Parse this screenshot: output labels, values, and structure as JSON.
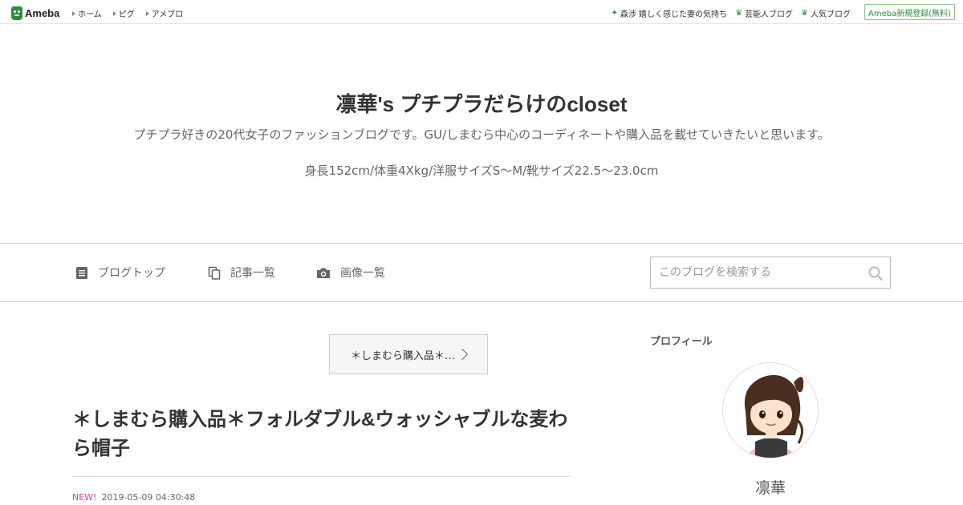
{
  "topbar": {
    "logo_text": "Ameba",
    "global_nav": [
      "ホーム",
      "ピグ",
      "アメブロ"
    ],
    "right_nav": [
      {
        "icon": "sparkle-icon",
        "label": "森渉 嬉しく感じた妻の気持ち"
      },
      {
        "icon": "crown-icon",
        "label": "芸能人ブログ"
      },
      {
        "icon": "crown-icon",
        "label": "人気ブログ"
      }
    ],
    "register_label": "Ameba新規登録(無料)"
  },
  "blog": {
    "title": "凛華's プチプラだらけのcloset",
    "description_1": "プチプラ好きの20代女子のファッションブログです。GU/しまむら中心のコーディネートや購入品を載せていきたいと思います。",
    "description_2": "身長152cm/体重4Xkg/洋服サイズS〜M/靴サイズ22.5〜23.0cm"
  },
  "blognav": {
    "items": [
      {
        "icon": "document-icon",
        "label": "ブログトップ"
      },
      {
        "icon": "copy-icon",
        "label": "記事一覧"
      },
      {
        "icon": "camera-icon",
        "label": "画像一覧"
      }
    ],
    "search_placeholder": "このブログを検索する"
  },
  "entry": {
    "category_label": "＊しまむら購入品＊…",
    "title": "＊しまむら購入品＊フォルダブル&ウォッシャブルな麦わら帽子",
    "new_badge": "NEW!",
    "datetime": "2019-05-09 04:30:48"
  },
  "sidebar": {
    "heading": "プロフィール",
    "profile_name": "凛華"
  },
  "colors": {
    "brand_green": "#2d8c3c",
    "new_pink": "#e13d9b"
  }
}
